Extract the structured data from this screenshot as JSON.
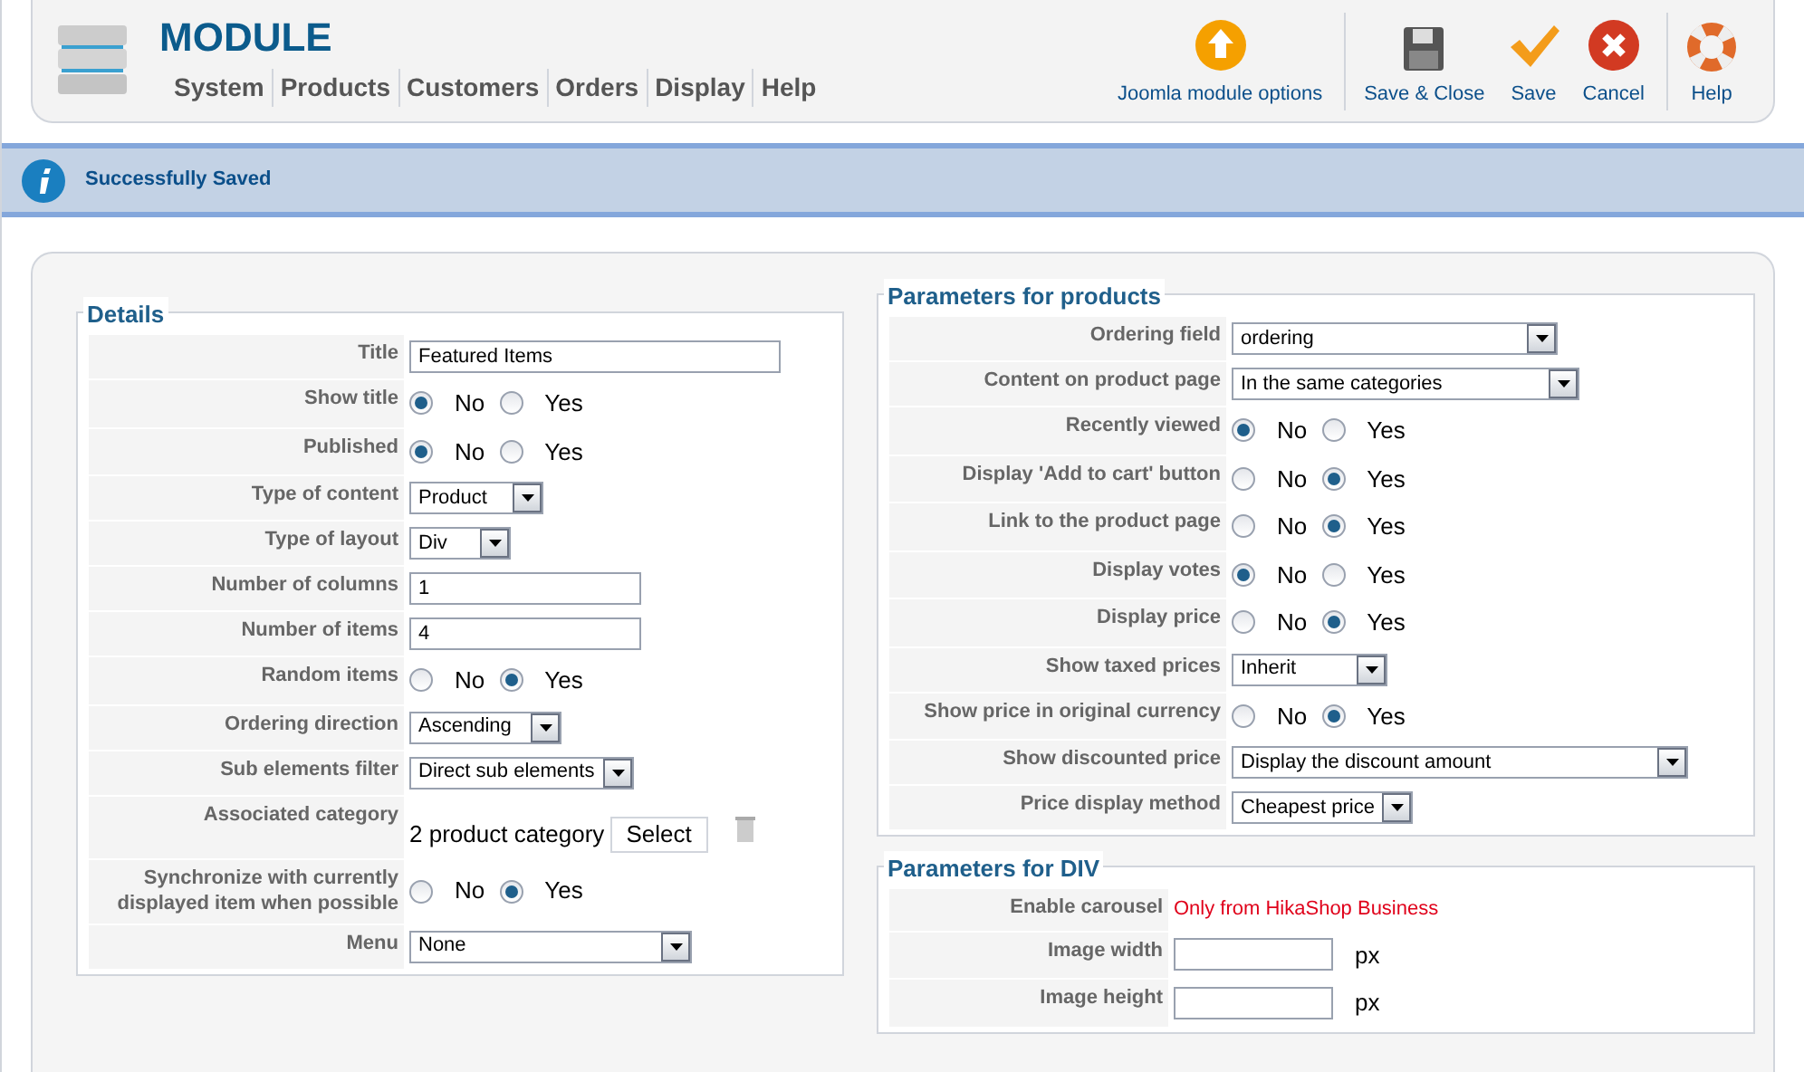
{
  "header": {
    "title": "MODULE",
    "menu": [
      "System",
      "Products",
      "Customers",
      "Orders",
      "Display",
      "Help"
    ],
    "toolbar": [
      {
        "kind": "options",
        "label": "Joomla module options"
      },
      {
        "kind": "save-close",
        "label": "Save & Close"
      },
      {
        "kind": "save",
        "label": "Save"
      },
      {
        "kind": "cancel",
        "label": "Cancel"
      },
      {
        "kind": "help",
        "label": "Help"
      }
    ]
  },
  "message": "Successfully Saved",
  "details": {
    "legend": "Details",
    "rows": [
      {
        "label": "Title",
        "kind": "text",
        "value": "Featured Items"
      },
      {
        "label": "Show title",
        "kind": "radio",
        "options": [
          {
            "label": "No",
            "selected": true
          },
          {
            "label": "Yes",
            "selected": false
          }
        ]
      },
      {
        "label": "Published",
        "kind": "radio",
        "options": [
          {
            "label": "No",
            "selected": true
          },
          {
            "label": "Yes",
            "selected": false
          }
        ]
      },
      {
        "label": "Type of content",
        "kind": "select",
        "value": "Product"
      },
      {
        "label": "Type of layout",
        "kind": "select",
        "value": "Div"
      },
      {
        "label": "Number of columns",
        "kind": "text",
        "value": "1"
      },
      {
        "label": "Number of items",
        "kind": "text",
        "value": "4"
      },
      {
        "label": "Random items",
        "kind": "radio",
        "options": [
          {
            "label": "No",
            "selected": false
          },
          {
            "label": "Yes",
            "selected": true
          }
        ]
      },
      {
        "label": "Ordering direction",
        "kind": "select",
        "value": "Ascending"
      },
      {
        "label": "Sub elements filter",
        "kind": "select",
        "value": "Direct sub elements"
      },
      {
        "label": "Associated category",
        "kind": "category",
        "value": "2 product category",
        "button": "Select"
      },
      {
        "label": "Synchronize with currently displayed item when possible",
        "kind": "radio",
        "options": [
          {
            "label": "No",
            "selected": false
          },
          {
            "label": "Yes",
            "selected": true
          }
        ]
      },
      {
        "label": "Menu",
        "kind": "select",
        "value": "None"
      }
    ]
  },
  "products": {
    "legend": "Parameters for products",
    "rows": [
      {
        "label": "Ordering field",
        "kind": "select",
        "value": "ordering"
      },
      {
        "label": "Content on product page",
        "kind": "select",
        "value": "In the same categories"
      },
      {
        "label": "Recently viewed",
        "kind": "radio",
        "options": [
          {
            "label": "No",
            "selected": true
          },
          {
            "label": "Yes",
            "selected": false
          }
        ]
      },
      {
        "label": "Display 'Add to cart' button",
        "kind": "radio",
        "options": [
          {
            "label": "No",
            "selected": false
          },
          {
            "label": "Yes",
            "selected": true
          }
        ]
      },
      {
        "label": "Link to the product page",
        "kind": "radio",
        "options": [
          {
            "label": "No",
            "selected": false
          },
          {
            "label": "Yes",
            "selected": true
          }
        ]
      },
      {
        "label": "Display votes",
        "kind": "radio",
        "options": [
          {
            "label": "No",
            "selected": true
          },
          {
            "label": "Yes",
            "selected": false
          }
        ]
      },
      {
        "label": "Display price",
        "kind": "radio",
        "options": [
          {
            "label": "No",
            "selected": false
          },
          {
            "label": "Yes",
            "selected": true
          }
        ]
      },
      {
        "label": "Show taxed prices",
        "kind": "select",
        "value": "Inherit"
      },
      {
        "label": "Show price in original currency",
        "kind": "radio",
        "options": [
          {
            "label": "No",
            "selected": false
          },
          {
            "label": "Yes",
            "selected": true
          }
        ]
      },
      {
        "label": "Show discounted price",
        "kind": "select",
        "value": "Display the discount amount"
      },
      {
        "label": "Price display method",
        "kind": "select",
        "value": "Cheapest price"
      }
    ]
  },
  "div": {
    "legend": "Parameters for DIV",
    "rows": [
      {
        "label": "Enable carousel",
        "kind": "note",
        "value": "Only from HikaShop Business"
      },
      {
        "label": "Image width",
        "kind": "px",
        "unit": "px"
      },
      {
        "label": "Image height",
        "kind": "px",
        "unit": "px"
      }
    ]
  }
}
